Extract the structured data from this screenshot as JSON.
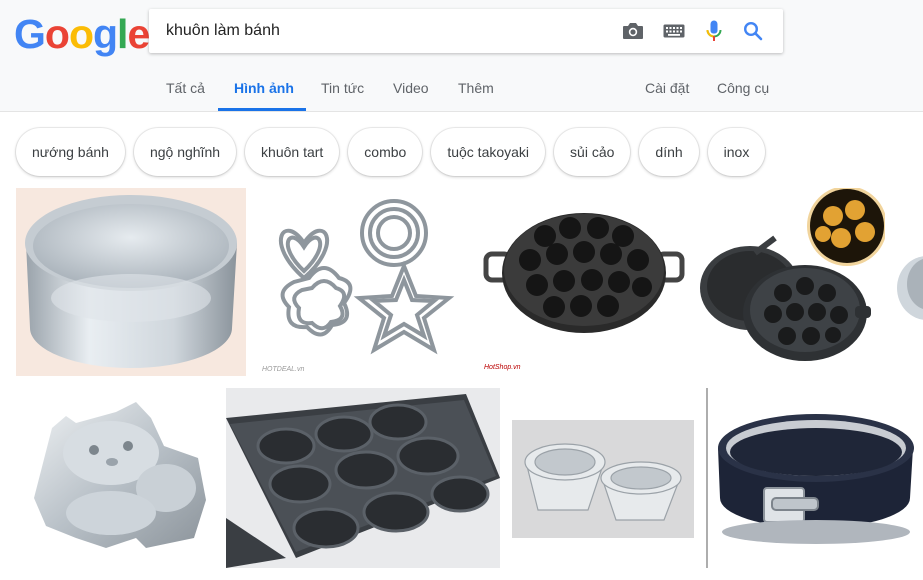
{
  "logo": {
    "text": "Google"
  },
  "search": {
    "query": "khuôn làm bánh"
  },
  "icons": {
    "camera": "camera-icon",
    "keyboard": "keyboard-icon",
    "mic": "microphone-icon",
    "search": "search-icon"
  },
  "tabs": [
    {
      "label": "Tất cả"
    },
    {
      "label": "Hình ảnh",
      "active": true
    },
    {
      "label": "Tin tức"
    },
    {
      "label": "Video"
    },
    {
      "label": "Thêm"
    }
  ],
  "tools": {
    "settings": "Cài đặt",
    "tools": "Công cụ"
  },
  "chips": [
    "nướng bánh",
    "ngộ nghĩnh",
    "khuôn tart",
    "combo",
    "tuộc takoyaki",
    "sủi cảo",
    "dính",
    "inox"
  ],
  "colors": {
    "accent": "#1a73e8",
    "header_bg": "#f8f9fa"
  },
  "results": [
    {
      "subject": "round aluminum cake pan"
    },
    {
      "subject": "heart, flower, star and round cookie cutter set",
      "watermark": "HOTDEAL.vn"
    },
    {
      "subject": "takoyaki pan",
      "watermark": "HotShop.vn"
    },
    {
      "subject": "cast iron pan with flower molds and baked pastries"
    },
    {
      "subject": "aluminum pan (cropped)"
    },
    {
      "subject": "Hello Kitty shaped aluminum cake mold"
    },
    {
      "subject": "non-stick 12 cup muffin tray"
    },
    {
      "subject": "fluted tart molds"
    },
    {
      "subject": "dark springform cake pan"
    }
  ]
}
